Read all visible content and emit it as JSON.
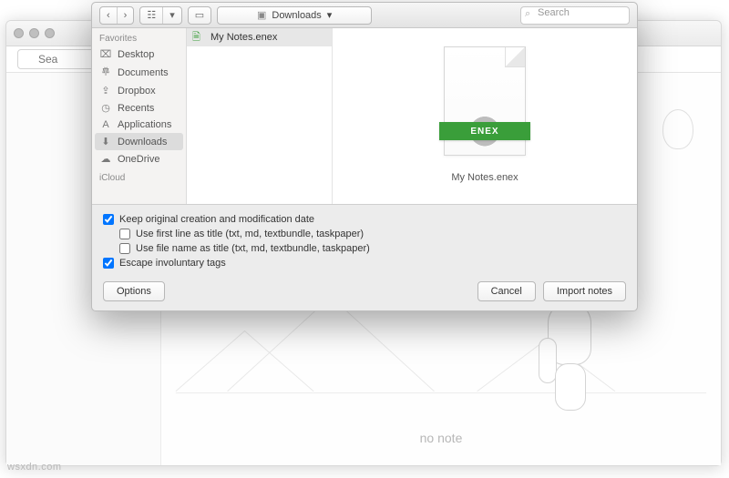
{
  "bg": {
    "search_placeholder": "Sea",
    "no_note": "no note",
    "watermark": "wsxdn.com"
  },
  "sheet": {
    "nav_back": "‹",
    "nav_fwd": "›",
    "view_seg": "☷",
    "path_label": "Downloads",
    "path_chevron": "▾",
    "search_placeholder": "Search"
  },
  "sidebar": {
    "header1": "Favorites",
    "items": [
      {
        "icon": "⌧",
        "label": "Desktop"
      },
      {
        "icon": "𐄷",
        "label": "Documents"
      },
      {
        "icon": "⇪",
        "label": "Dropbox"
      },
      {
        "icon": "◷",
        "label": "Recents"
      },
      {
        "icon": "A",
        "label": "Applications"
      },
      {
        "icon": "⬇",
        "label": "Downloads"
      },
      {
        "icon": "☁",
        "label": "OneDrive"
      }
    ],
    "header2": "iCloud"
  },
  "files": {
    "items": [
      {
        "icon": "🗎",
        "label": "My Notes.enex"
      }
    ]
  },
  "preview": {
    "badge": "ENEX",
    "name": "My Notes.enex"
  },
  "options": {
    "opt1": "Keep original creation and modification date",
    "opt2": "Use first line as title (txt, md, textbundle, taskpaper)",
    "opt3": "Use file name as title (txt, md, textbundle, taskpaper)",
    "opt4": "Escape involuntary tags"
  },
  "buttons": {
    "options": "Options",
    "cancel": "Cancel",
    "import": "Import notes"
  }
}
